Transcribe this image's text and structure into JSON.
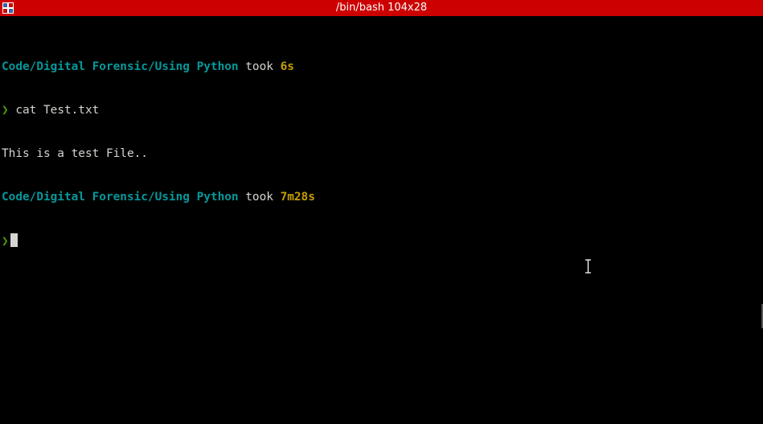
{
  "window": {
    "title": "/bin/bash 104x28",
    "accent": "#cc0000"
  },
  "terminal": {
    "lines": [
      {
        "path": "Code/Digital Forensic/Using Python",
        "took": " took ",
        "duration": "6s"
      },
      {
        "prompt": "❯",
        "command": " cat Test.txt"
      },
      {
        "output": "This is a test File.."
      },
      {
        "path": "Code/Digital Forensic/Using Python",
        "took": " took ",
        "duration": "7m28s"
      },
      {
        "prompt": "❯"
      }
    ],
    "colors": {
      "path": "#06989a",
      "duration": "#c4a000",
      "prompt": "#4e9a06",
      "text": "#d3d7cf"
    }
  },
  "icons": {
    "app": "terminal-app-icon",
    "mouse": "ibeam-cursor-icon"
  }
}
